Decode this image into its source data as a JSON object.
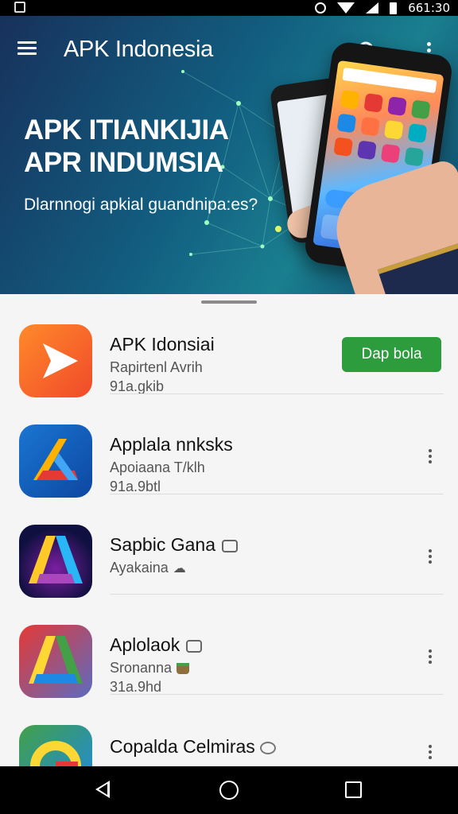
{
  "status_bar": {
    "time": "661:30"
  },
  "header": {
    "title": "APK Indonesia",
    "headline_line1": "APK ITIANKIJIA",
    "headline_line2": "APR INDUMSIA",
    "subtitle": "Dlarnnogi apkial guandnipa:es?"
  },
  "apps": [
    {
      "name": "APK Idonsiai",
      "subtitle": "Rapirtenl Avrih",
      "size": "91a.gkib",
      "action": "Dap bola",
      "icon": "play-icon"
    },
    {
      "name": "Applala nnksks",
      "subtitle": "Apoiaana T/klh",
      "size": "91a.9btl",
      "icon": "arrow-logo-icon"
    },
    {
      "name": "Sapbic Gana",
      "subtitle": "Ayakaina",
      "size": "",
      "icon": "a-logo-icon"
    },
    {
      "name": "Aplolaok",
      "subtitle": "Sronanna",
      "size": "31a.9hd",
      "icon": "triangle-logo-icon"
    },
    {
      "name": "Copalda Celmiras",
      "subtitle": "",
      "size": "",
      "icon": "g-logo-icon"
    }
  ],
  "colors": {
    "install_green": "#2c9c3c",
    "hero_teal": "#125e80",
    "sheet_bg": "#f5f5f5"
  }
}
